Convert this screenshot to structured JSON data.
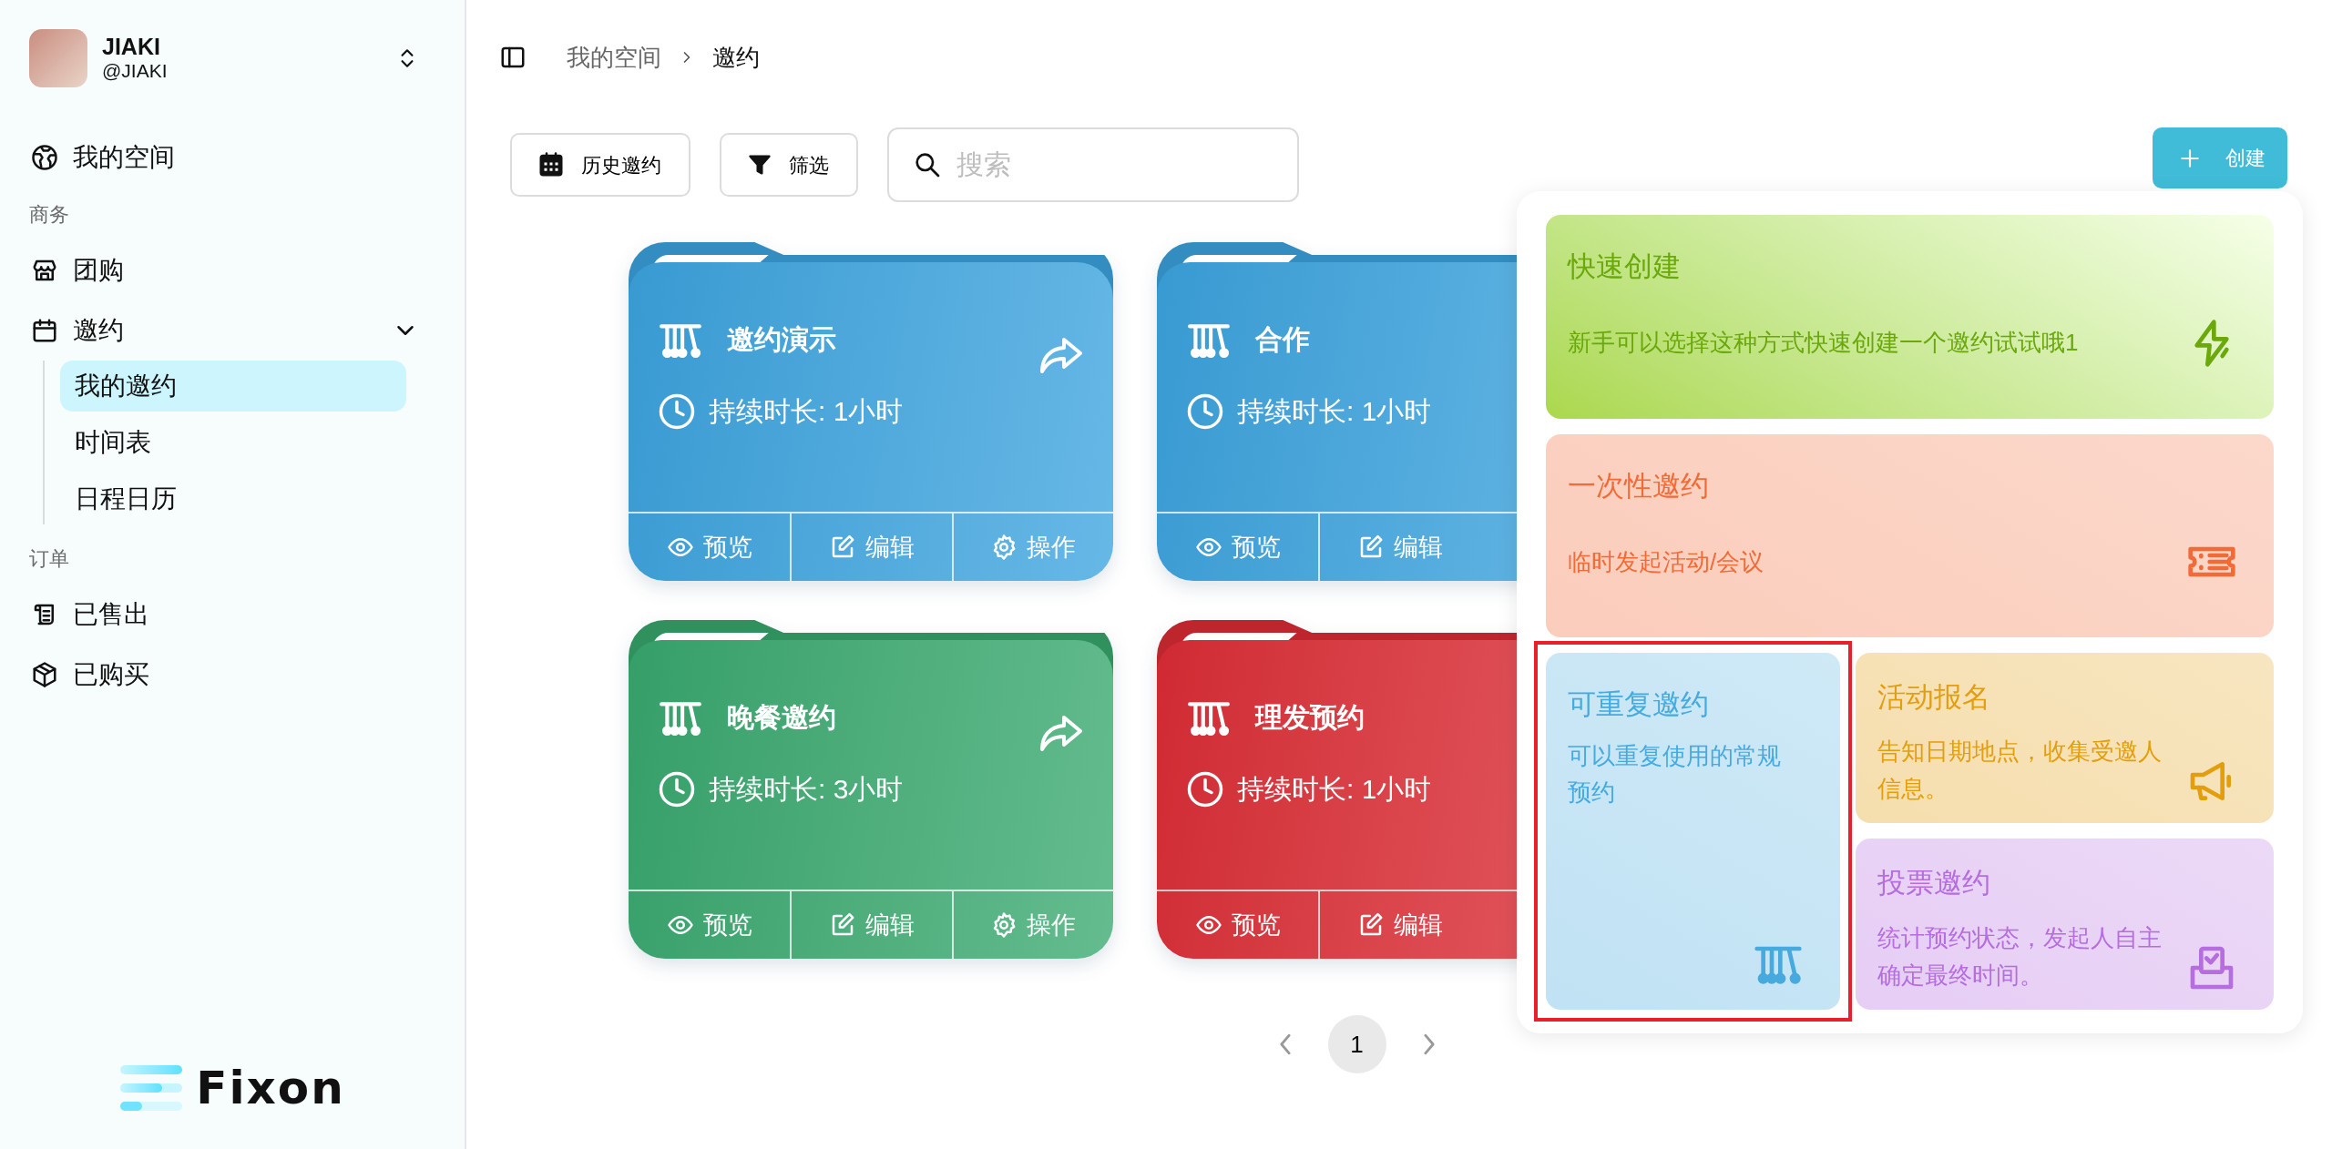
{
  "user": {
    "name": "JIAKI",
    "handle": "@JIAKI"
  },
  "nav": [
    {
      "kind": "item",
      "label": "我的空间"
    },
    {
      "kind": "section",
      "label": "商务"
    },
    {
      "kind": "item",
      "label": "团购"
    },
    {
      "kind": "group",
      "label": "邀约",
      "expanded": true,
      "children": [
        {
          "label": "我的邀约",
          "selected": true
        },
        {
          "label": "时间表",
          "selected": false
        },
        {
          "label": "日程日历",
          "selected": false
        }
      ]
    },
    {
      "kind": "section",
      "label": "订单"
    },
    {
      "kind": "item",
      "label": "已售出"
    },
    {
      "kind": "item",
      "label": "已购买"
    }
  ],
  "logo": {
    "text": "Fixon"
  },
  "breadcrumb": [
    {
      "label": "我的空间",
      "current": false
    },
    {
      "label": "邀约",
      "current": true
    }
  ],
  "toolbar": {
    "buttons": [
      "历史邀约",
      "筛选"
    ],
    "search": {
      "placeholder": "搜索"
    },
    "create_button": "创建"
  },
  "invitations": [
    {
      "title": "邀约演示",
      "duration": "持续时长: 1小时",
      "color": "#3ba4df",
      "share": true,
      "actions": [
        "预览",
        "编辑",
        "操作"
      ]
    },
    {
      "title": "合作",
      "duration": "持续时长: 1小时",
      "color": "#3ba4df",
      "actions": [
        "预览",
        "编辑"
      ]
    },
    {
      "title": "晚餐邀约",
      "duration": "持续时长: 3小时",
      "color": "#38a96f",
      "share": true,
      "actions": [
        "预览",
        "编辑",
        "操作"
      ]
    },
    {
      "title": "理发预约",
      "duration": "持续时长: 1小时",
      "color": "#dd2c36",
      "actions": [
        "预览",
        "编辑"
      ]
    }
  ],
  "pagination": {
    "pages": [
      {
        "label": "1",
        "selected": true
      }
    ]
  },
  "create_menu": {
    "options": [
      {
        "kind": "quick",
        "title": "快速创建",
        "description": "新手可以选择这种方式快速创建一个邀约试试哦1",
        "color": "#6aa80c",
        "highlighted": false
      },
      {
        "kind": "once",
        "title": "一次性邀约",
        "description": "临时发起活动/会议",
        "color": "#f26a36",
        "highlighted": false
      },
      {
        "kind": "repeat",
        "title": "可重复邀约",
        "description": "可以重复使用的常规预约",
        "color": "#46aade",
        "highlighted": true
      },
      {
        "kind": "signup",
        "title": "活动报名",
        "description": "告知日期地点，收集受邀人信息。",
        "color": "#e39e0e",
        "highlighted": false
      },
      {
        "kind": "vote",
        "title": "投票邀约",
        "description": "统计预约状态，发起人自主确定最终时间。",
        "color": "#b56ddf",
        "highlighted": false
      }
    ]
  }
}
